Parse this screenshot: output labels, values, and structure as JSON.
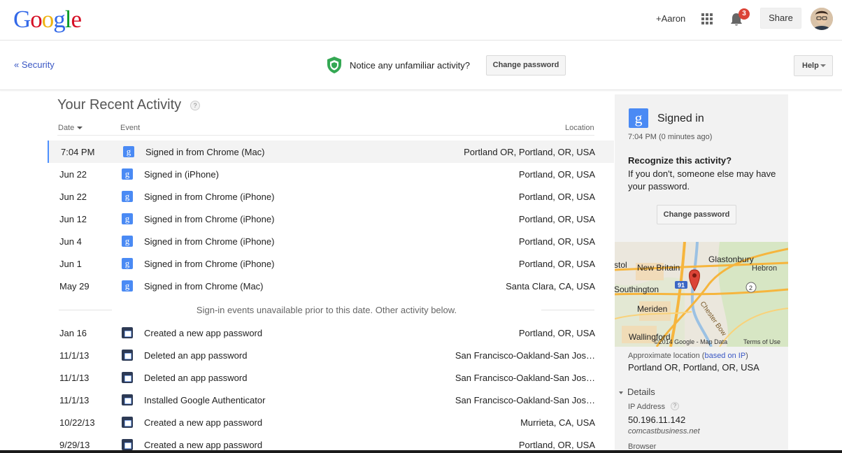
{
  "header": {
    "logo_letters": [
      "G",
      "o",
      "o",
      "g",
      "l",
      "e"
    ],
    "user_link": "+Aaron",
    "notification_count": "3",
    "share_label": "Share"
  },
  "subheader": {
    "back_link": "« Security",
    "notice": "Notice any unfamiliar activity?",
    "change_password_label": "Change password",
    "help_label": "Help"
  },
  "activity": {
    "title": "Your Recent Activity",
    "help_mark": "?",
    "columns": {
      "date": "Date",
      "event": "Event",
      "location": "Location"
    },
    "rows": [
      {
        "date": "7:04 PM",
        "icon": "google-g-icon",
        "event": "Signed in from Chrome (Mac)",
        "location": "Portland OR, Portland, OR, USA",
        "selected": true
      },
      {
        "date": "Jun 22",
        "icon": "google-g-icon",
        "event": "Signed in (iPhone)",
        "location": "Portland, OR, USA"
      },
      {
        "date": "Jun 22",
        "icon": "google-g-icon",
        "event": "Signed in from Chrome (iPhone)",
        "location": "Portland, OR, USA"
      },
      {
        "date": "Jun 12",
        "icon": "google-g-icon",
        "event": "Signed in from Chrome (iPhone)",
        "location": "Portland, OR, USA"
      },
      {
        "date": "Jun 4",
        "icon": "google-g-icon",
        "event": "Signed in from Chrome (iPhone)",
        "location": "Portland, OR, USA"
      },
      {
        "date": "Jun 1",
        "icon": "google-g-icon",
        "event": "Signed in from Chrome (iPhone)",
        "location": "Portland, OR, USA"
      },
      {
        "date": "May 29",
        "icon": "google-g-icon",
        "event": "Signed in from Chrome (Mac)",
        "location": "Santa Clara, CA, USA"
      }
    ],
    "divider_note": "Sign-in events unavailable prior to this date. Other activity below.",
    "other_rows": [
      {
        "date": "Jan 16",
        "icon": "app-password-icon",
        "event": "Created a new app password",
        "location": "Portland, OR, USA"
      },
      {
        "date": "11/1/13",
        "icon": "app-password-icon",
        "event": "Deleted an app password",
        "location": "San Francisco-Oakland-San Jos…"
      },
      {
        "date": "11/1/13",
        "icon": "app-password-icon",
        "event": "Deleted an app password",
        "location": "San Francisco-Oakland-San Jos…"
      },
      {
        "date": "11/1/13",
        "icon": "app-password-icon",
        "event": "Installed Google Authenticator",
        "location": "San Francisco-Oakland-San Jos…"
      },
      {
        "date": "10/22/13",
        "icon": "app-password-icon",
        "event": "Created a new app password",
        "location": "Murrieta, CA, USA"
      },
      {
        "date": "9/29/13",
        "icon": "app-password-icon",
        "event": "Created a new app password",
        "location": "Portland, OR, USA"
      }
    ]
  },
  "side_panel": {
    "g_letter": "g",
    "title": "Signed in",
    "time": "7:04 PM (0 minutes ago)",
    "question": "Recognize this activity?",
    "description": "If you don't, someone else may have your password.",
    "change_password_label": "Change password",
    "map": {
      "labels": [
        "stol",
        "New Britain",
        "Glastonbury",
        "Hebron",
        "Southington",
        "Meriden",
        "Wallingford",
        "Chester Bow",
        "91",
        "2"
      ],
      "copyright": "©2014 Google - Map Data",
      "terms": "Terms of Use"
    },
    "approx_label": "Approximate location (",
    "approx_link": "based on IP",
    "approx_close": ")",
    "location": "Portland OR, Portland, OR, USA",
    "details_label": "Details",
    "ip_label": "IP Address",
    "ip_help": "?",
    "ip_value": "50.196.11.142",
    "ip_host": "comcastbusiness.net",
    "browser_label": "Browser"
  },
  "colors": {
    "accent_blue": "#4a8af4",
    "link_blue": "#3a57c4",
    "badge_red": "#db4437",
    "shield_green": "#34a853",
    "selection_border": "#4d90fe"
  }
}
